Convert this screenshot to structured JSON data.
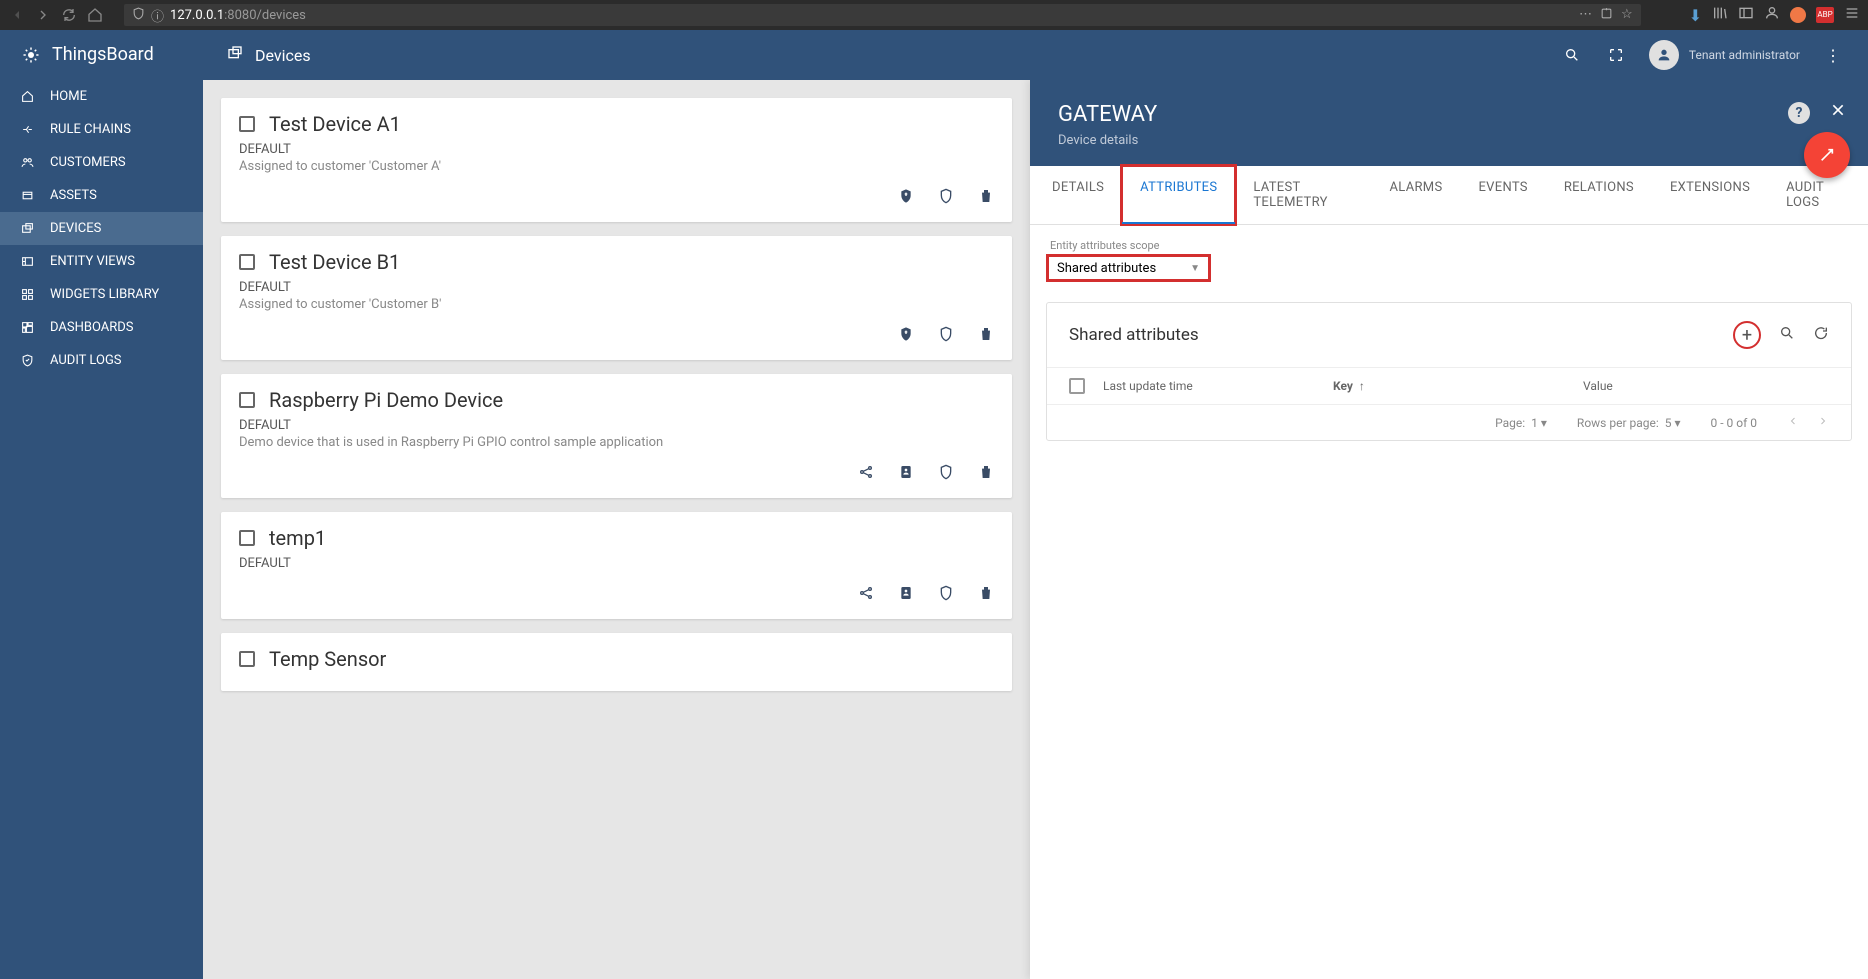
{
  "browser": {
    "url_host": "127.0.0.1",
    "url_path": ":8080/devices"
  },
  "app": {
    "brand": "ThingsBoard",
    "page_title": "Devices",
    "user_label": "Tenant administrator"
  },
  "sidebar": {
    "items": [
      {
        "label": "HOME"
      },
      {
        "label": "RULE CHAINS"
      },
      {
        "label": "CUSTOMERS"
      },
      {
        "label": "ASSETS"
      },
      {
        "label": "DEVICES"
      },
      {
        "label": "ENTITY VIEWS"
      },
      {
        "label": "WIDGETS LIBRARY"
      },
      {
        "label": "DASHBOARDS"
      },
      {
        "label": "AUDIT LOGS"
      }
    ]
  },
  "devices": [
    {
      "name": "Test Device A1",
      "type": "DEFAULT",
      "desc": "Assigned to customer 'Customer A'",
      "actions": [
        "assign",
        "shield",
        "delete"
      ]
    },
    {
      "name": "Test Device B1",
      "type": "DEFAULT",
      "desc": "Assigned to customer 'Customer B'",
      "actions": [
        "assign",
        "shield",
        "delete"
      ]
    },
    {
      "name": "Raspberry Pi Demo Device",
      "type": "DEFAULT",
      "desc": "Demo device that is used in Raspberry Pi GPIO control sample application",
      "actions": [
        "share",
        "card",
        "shield",
        "delete"
      ]
    },
    {
      "name": "temp1",
      "type": "DEFAULT",
      "desc": "",
      "actions": [
        "share",
        "card",
        "shield",
        "delete"
      ]
    },
    {
      "name": "Temp Sensor",
      "type": "",
      "desc": "",
      "actions": []
    }
  ],
  "details": {
    "title": "GATEWAY",
    "subtitle": "Device details",
    "tabs": [
      {
        "label": "DETAILS",
        "active": false,
        "highlighted": false
      },
      {
        "label": "ATTRIBUTES",
        "active": true,
        "highlighted": true
      },
      {
        "label": "LATEST TELEMETRY",
        "active": false,
        "highlighted": false
      },
      {
        "label": "ALARMS",
        "active": false,
        "highlighted": false
      },
      {
        "label": "EVENTS",
        "active": false,
        "highlighted": false
      },
      {
        "label": "RELATIONS",
        "active": false,
        "highlighted": false
      },
      {
        "label": "EXTENSIONS",
        "active": false,
        "highlighted": false
      },
      {
        "label": "AUDIT LOGS",
        "active": false,
        "highlighted": false
      }
    ],
    "scope_label": "Entity attributes scope",
    "scope_value": "Shared attributes",
    "attr_title": "Shared attributes",
    "columns": {
      "last_update": "Last update time",
      "key": "Key",
      "value": "Value"
    },
    "pager": {
      "page_label": "Page:",
      "page": "1",
      "rows_label": "Rows per page:",
      "rows": "5",
      "range": "0 - 0 of 0"
    }
  }
}
